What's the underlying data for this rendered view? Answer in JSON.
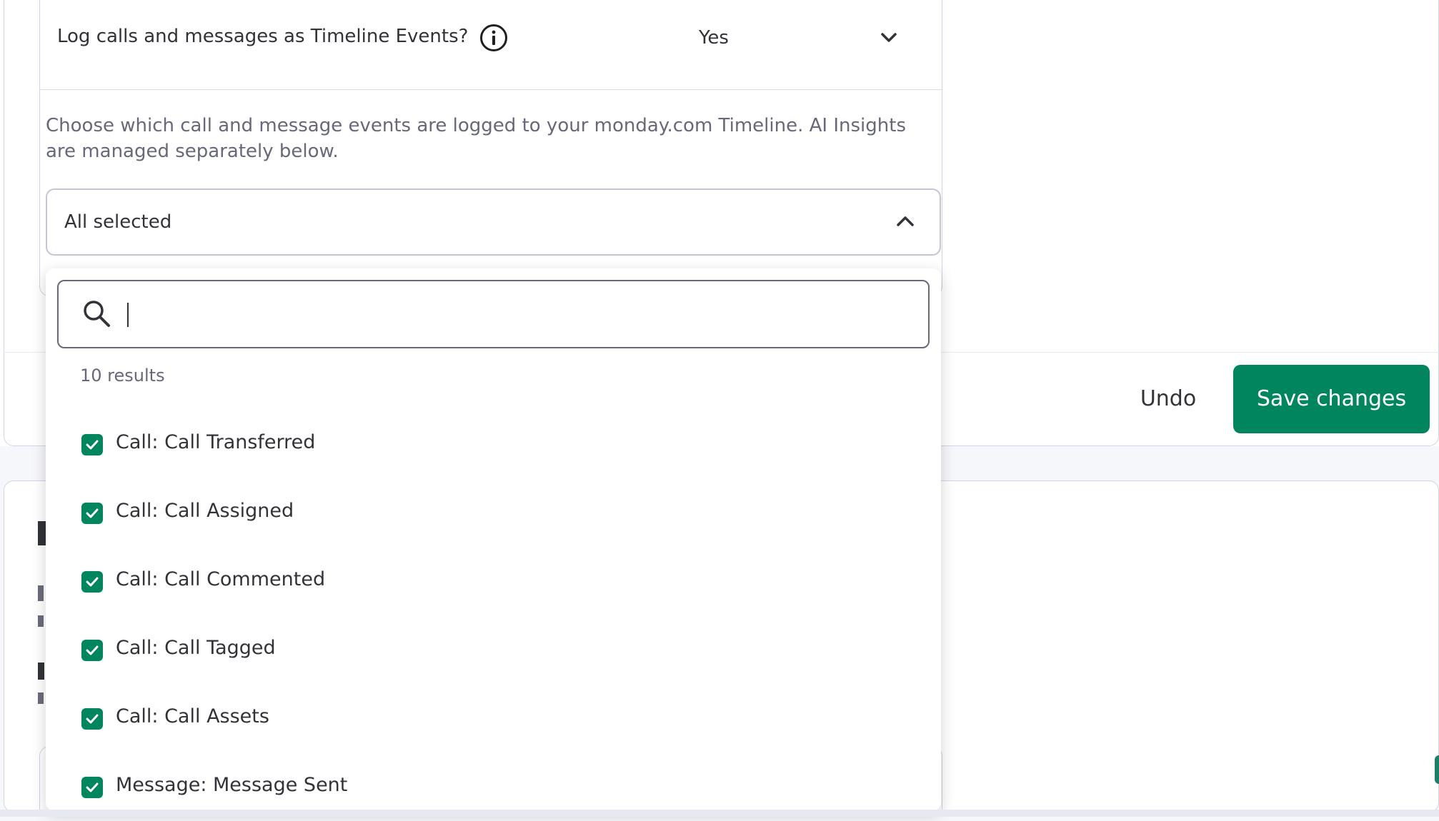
{
  "field": {
    "label": "Log calls and messages as Timeline Events?",
    "value": "Yes"
  },
  "description": "Choose which call and message events are logged to your monday.com Timeline. AI Insights are managed separately below.",
  "select": {
    "value": "All selected"
  },
  "dropdown": {
    "search_value": "",
    "results_count": "10 results",
    "options": [
      {
        "label": "Call: Call Transferred",
        "checked": true
      },
      {
        "label": "Call: Call Assigned",
        "checked": true
      },
      {
        "label": "Call: Call Commented",
        "checked": true
      },
      {
        "label": "Call: Call Tagged",
        "checked": true
      },
      {
        "label": "Call: Call Assets",
        "checked": true
      },
      {
        "label": "Message: Message Sent",
        "checked": true
      }
    ]
  },
  "actions": {
    "undo_label": "Undo",
    "save_label": "Save changes"
  },
  "colors": {
    "accent": "#00855f",
    "text": "#323338",
    "muted": "#676879",
    "border": "#d0d4e4"
  }
}
